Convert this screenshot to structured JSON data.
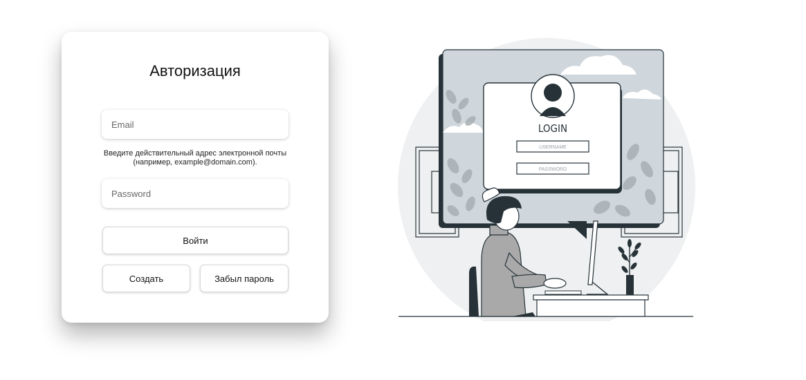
{
  "auth_card": {
    "title": "Авторизация",
    "email_placeholder": "Email",
    "email_hint": "Введите действительный адрес электронной почты (например, example@domain.com).",
    "password_placeholder": "Password",
    "login_label": "Войти",
    "create_label": "Создать",
    "forgot_label": "Забыл пароль"
  },
  "illustration": {
    "heading": "LOGIN",
    "username_placeholder": "USERNAME",
    "password_placeholder": "PASSWORD"
  }
}
